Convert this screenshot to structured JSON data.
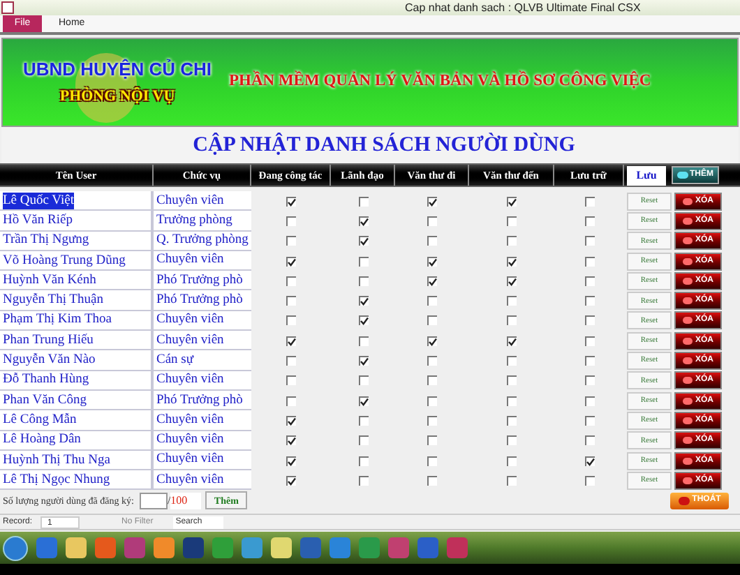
{
  "window": {
    "title": "Cap nhat danh sach : QLVB Ultimate Final CSX"
  },
  "ribbon_tabs": [
    {
      "label": "File",
      "kind": "file"
    },
    {
      "label": "Home",
      "kind": "tab"
    }
  ],
  "banner": {
    "org": "UBND HUYỆN CỦ CHI",
    "dept": "PHÒNG NỘI VỤ",
    "app_name": "PHẦN MỀM QUẢN LÝ VĂN BẢN VÀ HỒ SƠ CÔNG VIỆC"
  },
  "form_title": "CẬP NHẬT DANH SÁCH NGƯỜI DÙNG",
  "table": {
    "columns": [
      "Tên User",
      "Chức vụ",
      "Đang công tác",
      "Lãnh đạo",
      "Văn thư đi",
      "Văn thư đến",
      "Lưu trữ"
    ],
    "save_button": "Lưu",
    "add_button": "THÊM",
    "rows": [
      {
        "name": "Lê Quốc Việt",
        "position": "Chuyên viên",
        "selected": true,
        "flags": [
          true,
          false,
          true,
          true,
          false
        ],
        "reset": "Reset",
        "delete": "XÓA"
      },
      {
        "name": "Hồ Văn Riếp",
        "position": "Trưởng phòng",
        "selected": false,
        "flags": [
          false,
          true,
          false,
          false,
          false
        ],
        "reset": "Reset",
        "delete": "XÓA"
      },
      {
        "name": "Trần Thị Ngưng",
        "position": "Q. Trưởng phòng",
        "selected": false,
        "flags": [
          false,
          true,
          false,
          false,
          false
        ],
        "reset": "Reset",
        "delete": "XÓA"
      },
      {
        "name": "Võ Hoàng Trung Dũng",
        "position": "Chuyên viên",
        "selected": false,
        "flags": [
          true,
          false,
          true,
          true,
          false
        ],
        "reset": "Reset",
        "delete": "XÓA"
      },
      {
        "name": "Huỳnh Văn Kénh",
        "position": "Phó Trưởng phò",
        "selected": false,
        "flags": [
          false,
          false,
          true,
          true,
          false
        ],
        "reset": "Reset",
        "delete": "XÓA"
      },
      {
        "name": "Nguyễn Thị Thuận",
        "position": "Phó Trưởng phò",
        "selected": false,
        "flags": [
          false,
          true,
          false,
          false,
          false
        ],
        "reset": "Reset",
        "delete": "XÓA"
      },
      {
        "name": "Phạm Thị Kim Thoa",
        "position": "Chuyên viên",
        "selected": false,
        "flags": [
          false,
          true,
          false,
          false,
          false
        ],
        "reset": "Reset",
        "delete": "XÓA"
      },
      {
        "name": "Phan Trung Hiếu",
        "position": "Chuyên viên",
        "selected": false,
        "flags": [
          true,
          false,
          true,
          true,
          false
        ],
        "reset": "Reset",
        "delete": "XÓA"
      },
      {
        "name": "Nguyễn Văn Nào",
        "position": "Cán sự",
        "selected": false,
        "flags": [
          false,
          true,
          false,
          false,
          false
        ],
        "reset": "Reset",
        "delete": "XÓA"
      },
      {
        "name": "Đỗ Thanh Hùng",
        "position": "Chuyên viên",
        "selected": false,
        "flags": [
          false,
          false,
          false,
          false,
          false
        ],
        "reset": "Reset",
        "delete": "XÓA"
      },
      {
        "name": "Phan Văn Công",
        "position": "Phó Trưởng phò",
        "selected": false,
        "flags": [
          false,
          true,
          false,
          false,
          false
        ],
        "reset": "Reset",
        "delete": "XÓA"
      },
      {
        "name": "Lê Công Mẫn",
        "position": "Chuyên viên",
        "selected": false,
        "flags": [
          true,
          false,
          false,
          false,
          false
        ],
        "reset": "Reset",
        "delete": "XÓA"
      },
      {
        "name": "Lê Hoàng Dân",
        "position": "Chuyên viên",
        "selected": false,
        "flags": [
          true,
          false,
          false,
          false,
          false
        ],
        "reset": "Reset",
        "delete": "XÓA"
      },
      {
        "name": "Huỳnh Thị Thu Nga",
        "position": "Chuyên viên",
        "selected": false,
        "flags": [
          true,
          false,
          false,
          false,
          true
        ],
        "reset": "Reset",
        "delete": "XÓA"
      },
      {
        "name": "Lê Thị Ngọc Nhung",
        "position": "Chuyên viên",
        "selected": false,
        "flags": [
          true,
          false,
          false,
          false,
          false
        ],
        "reset": "Reset",
        "delete": "XÓA"
      }
    ]
  },
  "footer": {
    "count_label": "Số lượng người dùng đã đăng ký:",
    "separator": "/",
    "max": "100",
    "add_button": "Thêm",
    "exit_button": "THOÁT"
  },
  "record_nav": {
    "label": "Record:",
    "current": "1",
    "filter": "No Filter",
    "search": "Search"
  }
}
